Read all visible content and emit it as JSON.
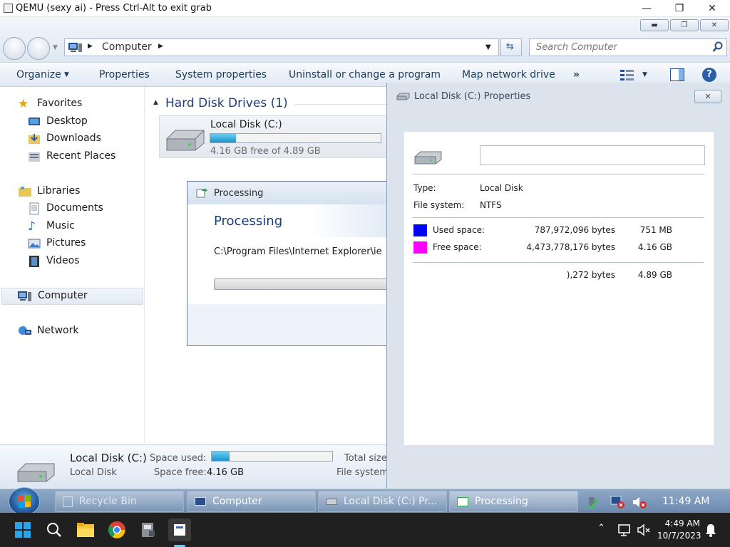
{
  "host": {
    "title": "QEMU (sexy ai) - Press Ctrl-Alt to exit grab"
  },
  "explorer": {
    "address": {
      "crumb": "Computer"
    },
    "search": {
      "placeholder": "Search Computer"
    },
    "commands": [
      "Organize",
      "Properties",
      "System properties",
      "Uninstall or change a program",
      "Map network drive",
      "»"
    ],
    "nav": {
      "favorites": "Favorites",
      "favorite_items": [
        "Desktop",
        "Downloads",
        "Recent Places"
      ],
      "libraries": "Libraries",
      "library_items": [
        "Documents",
        "Music",
        "Pictures",
        "Videos"
      ],
      "computer": "Computer",
      "network": "Network"
    },
    "group_header": "Hard Disk Drives (1)",
    "drive": {
      "name": "Local Disk (C:)",
      "free_text": "4.16 GB free of 4.89 GB",
      "used_fraction": 0.15
    },
    "details": {
      "name": "Local Disk (C:)",
      "type": "Local Disk",
      "space_used_label": "Space used:",
      "space_free_label": "Space free:",
      "space_free_value": "4.16 GB",
      "total_size_label": "Total size",
      "file_system_label": "File system"
    }
  },
  "processing_dialog": {
    "title": "Processing",
    "heading": "Processing",
    "path": "C:\\Program Files\\Internet Explorer\\ie"
  },
  "properties_dialog": {
    "title": "Local Disk (C:) Properties",
    "label_value": "",
    "type_label": "Type:",
    "type_value": "Local Disk",
    "fs_label": "File system:",
    "fs_value": "NTFS",
    "used_label": "Used space:",
    "used_bytes": "787,972,096 bytes",
    "used_short": "751 MB",
    "free_label": "Free space:",
    "free_bytes": "4,473,778,176 bytes",
    "free_short": "4.16 GB",
    "capacity_bytes": "),272 bytes",
    "capacity_short": "4.89 GB",
    "used_color": "#0000ff",
    "free_color": "#ff00ff"
  },
  "w7_taskbar": {
    "items": [
      "Recycle Bin",
      "Computer",
      "Local Disk (C:) Pr...",
      "Processing"
    ],
    "clock": "11:49 AM"
  },
  "w11_taskbar": {
    "time": "4:49 AM",
    "date": "10/7/2023"
  }
}
